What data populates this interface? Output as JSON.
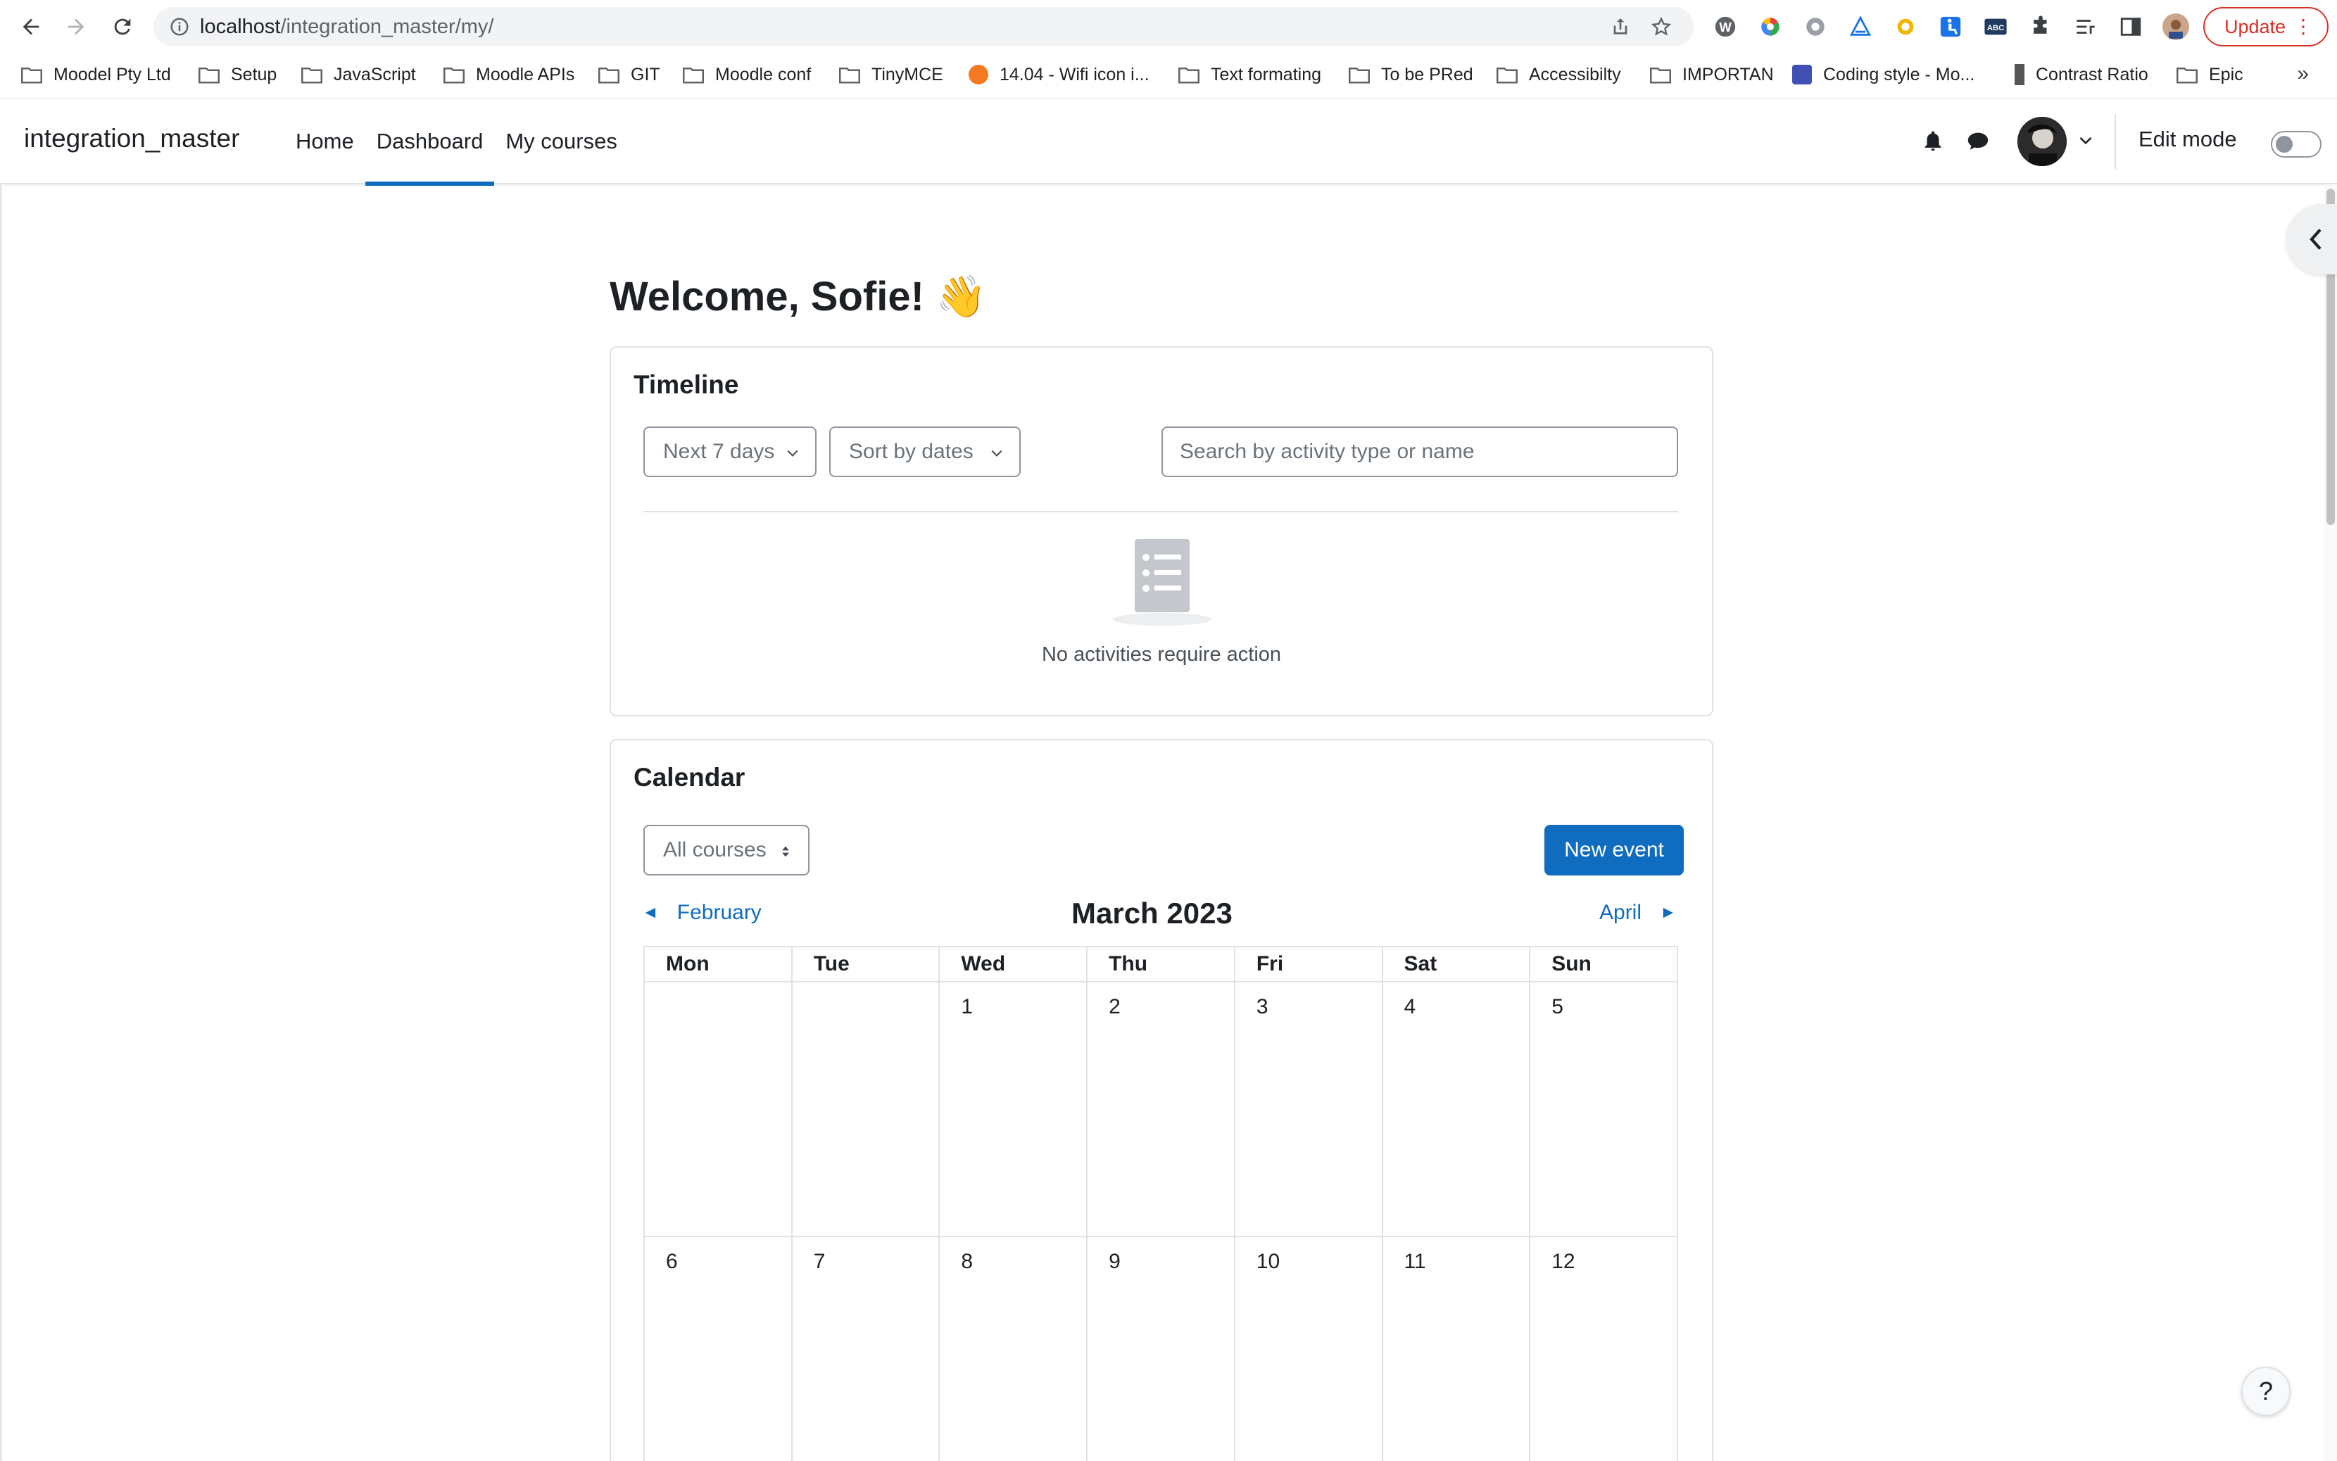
{
  "browser": {
    "url_host": "localhost",
    "url_path": "/integration_master/my/",
    "update_label": "Update",
    "bookmarks": [
      {
        "label": "Moodel Pty Ltd",
        "icon": "folder-icon"
      },
      {
        "label": "Setup",
        "icon": "folder-icon"
      },
      {
        "label": "JavaScript",
        "icon": "folder-icon"
      },
      {
        "label": "Moodle APIs",
        "icon": "folder-icon"
      },
      {
        "label": "GIT",
        "icon": "folder-icon"
      },
      {
        "label": "Moodle conf",
        "icon": "folder-icon"
      },
      {
        "label": "TinyMCE",
        "icon": "folder-icon"
      },
      {
        "label": "14.04 - Wifi icon i...",
        "icon": "askubuntu-icon"
      },
      {
        "label": "Text formating",
        "icon": "folder-icon"
      },
      {
        "label": "To be PRed",
        "icon": "folder-icon"
      },
      {
        "label": "Accessibilty",
        "icon": "folder-icon"
      },
      {
        "label": "IMPORTAN",
        "icon": "folder-icon"
      },
      {
        "label": "Coding style - Mo...",
        "icon": "moodle-icon"
      },
      {
        "label": "Contrast Ratio",
        "icon": "page-icon"
      },
      {
        "label": "Epic",
        "icon": "folder-icon"
      }
    ],
    "bookmarks_more": "»"
  },
  "navbar": {
    "site_name": "integration_master",
    "items": [
      {
        "label": "Home",
        "active": false
      },
      {
        "label": "Dashboard",
        "active": true
      },
      {
        "label": "My courses",
        "active": false
      }
    ],
    "edit_mode_label": "Edit mode",
    "edit_mode_on": false
  },
  "page": {
    "welcome": "Welcome, Sofie!",
    "welcome_emoji": "👋"
  },
  "timeline": {
    "title": "Timeline",
    "filter_label": "Next 7 days",
    "sort_label": "Sort by dates",
    "search_placeholder": "Search by activity type or name",
    "empty_message": "No activities require action"
  },
  "calendar": {
    "title": "Calendar",
    "course_filter": "All courses",
    "new_event_label": "New event",
    "prev_month": "February",
    "current_month": "March 2023",
    "next_month": "April",
    "weekdays": [
      "Mon",
      "Tue",
      "Wed",
      "Thu",
      "Fri",
      "Sat",
      "Sun"
    ],
    "weeks": [
      [
        "",
        "",
        "1",
        "2",
        "3",
        "4",
        "5"
      ],
      [
        "6",
        "7",
        "8",
        "9",
        "10",
        "11",
        "12"
      ]
    ]
  },
  "help_label": "?",
  "colors": {
    "brand": "#0f6cbf",
    "text": "#1d2125",
    "border": "#dee2e6",
    "update": "#d93025"
  }
}
